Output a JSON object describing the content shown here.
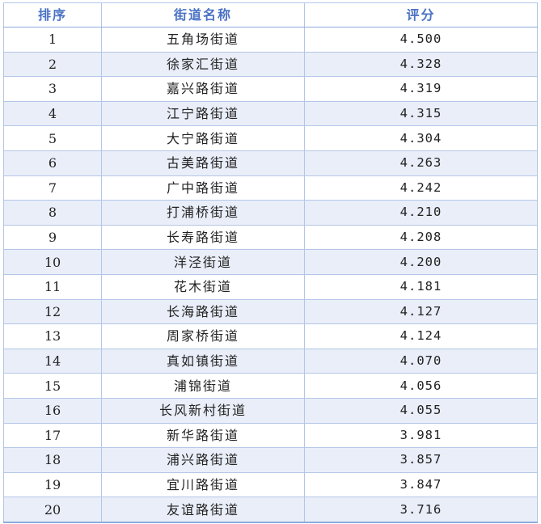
{
  "table": {
    "headers": {
      "rank": "排序",
      "name": "街道名称",
      "score": "评分"
    },
    "rows": [
      {
        "rank": "1",
        "name": "五角场街道",
        "score": "4.500"
      },
      {
        "rank": "2",
        "name": "徐家汇街道",
        "score": "4.328"
      },
      {
        "rank": "3",
        "name": "嘉兴路街道",
        "score": "4.319"
      },
      {
        "rank": "4",
        "name": "江宁路街道",
        "score": "4.315"
      },
      {
        "rank": "5",
        "name": "大宁路街道",
        "score": "4.304"
      },
      {
        "rank": "6",
        "name": "古美路街道",
        "score": "4.263"
      },
      {
        "rank": "7",
        "name": "广中路街道",
        "score": "4.242"
      },
      {
        "rank": "8",
        "name": "打浦桥街道",
        "score": "4.210"
      },
      {
        "rank": "9",
        "name": "长寿路街道",
        "score": "4.208"
      },
      {
        "rank": "10",
        "name": "洋泾街道",
        "score": "4.200"
      },
      {
        "rank": "11",
        "name": "花木街道",
        "score": "4.181"
      },
      {
        "rank": "12",
        "name": "长海路街道",
        "score": "4.127"
      },
      {
        "rank": "13",
        "name": "周家桥街道",
        "score": "4.124"
      },
      {
        "rank": "14",
        "name": "真如镇街道",
        "score": "4.070"
      },
      {
        "rank": "15",
        "name": "浦锦街道",
        "score": "4.056"
      },
      {
        "rank": "16",
        "name": "长风新村街道",
        "score": "4.055"
      },
      {
        "rank": "17",
        "name": "新华路街道",
        "score": "3.981"
      },
      {
        "rank": "18",
        "name": "浦兴路街道",
        "score": "3.857"
      },
      {
        "rank": "19",
        "name": "宜川路街道",
        "score": "3.847"
      },
      {
        "rank": "20",
        "name": "友谊路街道",
        "score": "3.716"
      }
    ]
  },
  "colors": {
    "header_text": "#4a72c4",
    "border": "#b4c6e7",
    "alt_row": "#e9eef8"
  }
}
